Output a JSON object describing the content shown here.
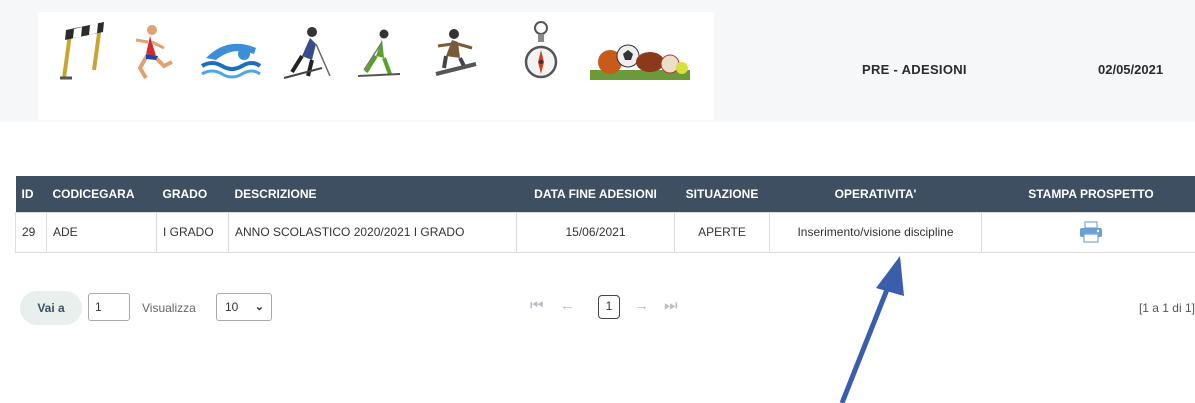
{
  "header": {
    "title": "PRE - ADESIONI",
    "date": "02/05/2021",
    "sport_icons": [
      "hurdle-icon",
      "runner-icon",
      "swimming-icon",
      "skier-icon",
      "cross-country-ski-icon",
      "snowboard-icon",
      "orienteering-compass-icon",
      "sports-balls-icon"
    ]
  },
  "table": {
    "columns": [
      "ID",
      "CODICEGARA",
      "GRADO",
      "DESCRIZIONE",
      "DATA FINE ADESIONI",
      "SITUAZIONE",
      "OPERATIVITA'",
      "STAMPA PROSPETTO"
    ],
    "rows": [
      {
        "id": "29",
        "codicegara": "ADE",
        "grado": "I GRADO",
        "descrizione": "ANNO SCOLASTICO 2020/2021 I GRADO",
        "data_fine": "15/06/2021",
        "situazione": "APERTE",
        "operativita": "Inserimento/visione discipline",
        "stampa_icon": "printer-icon"
      }
    ]
  },
  "pager": {
    "goto_label": "Vai a",
    "goto_value": "1",
    "show_label": "Visualizza",
    "page_size": "10",
    "current_page": "1",
    "range_info": "[1 a 1 di 1]"
  },
  "annotation": {
    "arrow_color": "#3a5eab"
  },
  "colors": {
    "header_bg": "#3d4f61",
    "status_green": "#3cc43c"
  }
}
